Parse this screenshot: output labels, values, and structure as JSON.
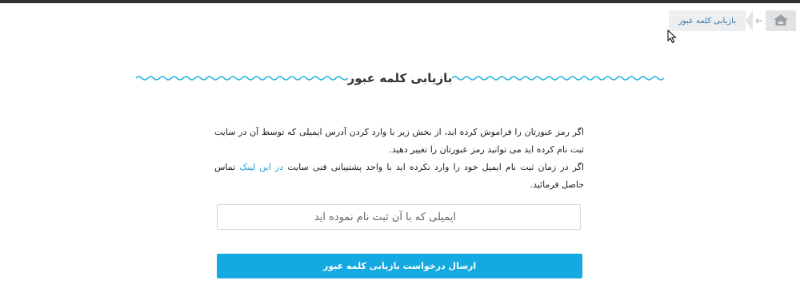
{
  "breadcrumb": {
    "home_icon": "home-icon",
    "current": "بازیابی کلمه عبور"
  },
  "page_title": "بازیابی کلمه عبور",
  "description": {
    "line1": "اگر رمز عبورتان را فراموش کرده اید، از بخش زیر با وارد کردن آدرس ایمیلی که توسط آن در سایت ثبت نام کرده اید می توانید رمز عبورتان را تغییر دهید.",
    "line2_before": "اگر در زمان ثبت نام ایمیل خود را وارد نکرده اید با واحد پشتیبانی فنی سایت ",
    "line2_link": "در این لینک",
    "line2_after": " تماس حاصل فرمائید."
  },
  "email_field": {
    "placeholder": "ایمیلی که با آن ثبت نام نموده اید"
  },
  "submit_label": "ارسال درخواست بازیابی کلمه عبور",
  "colors": {
    "accent": "#14a9e0",
    "wave": "#22b0e3",
    "link": "#1e9bd6",
    "topbar": "#2f3338"
  }
}
